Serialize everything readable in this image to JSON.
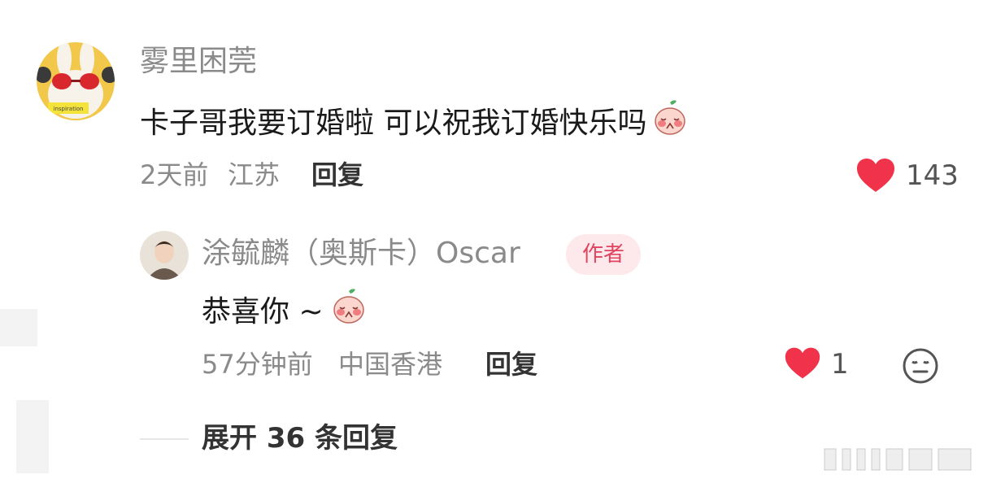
{
  "colors": {
    "heart": "#f0334a",
    "badge_bg": "#fde8ec",
    "badge_text": "#e0445f",
    "meta_text": "#8a8a8a",
    "body_text": "#1a1a1a"
  },
  "comment": {
    "username": "雾里困莞",
    "text": "卡子哥我要订婚啦 可以祝我订婚快乐吗",
    "emoji": "peach-face-emoji",
    "time": "2天前",
    "location": "江苏",
    "reply_label": "回复",
    "like_count": "143",
    "avatar_caption": "inspiration"
  },
  "reply": {
    "username": "涂毓麟（奥斯卡）Oscar",
    "badge": "作者",
    "text": "恭喜你 ~",
    "emoji": "peach-face-emoji",
    "time": "57分钟前",
    "location": "中国香港",
    "reply_label": "回复",
    "like_count": "1"
  },
  "expand": {
    "label": "展开 36 条回复"
  }
}
